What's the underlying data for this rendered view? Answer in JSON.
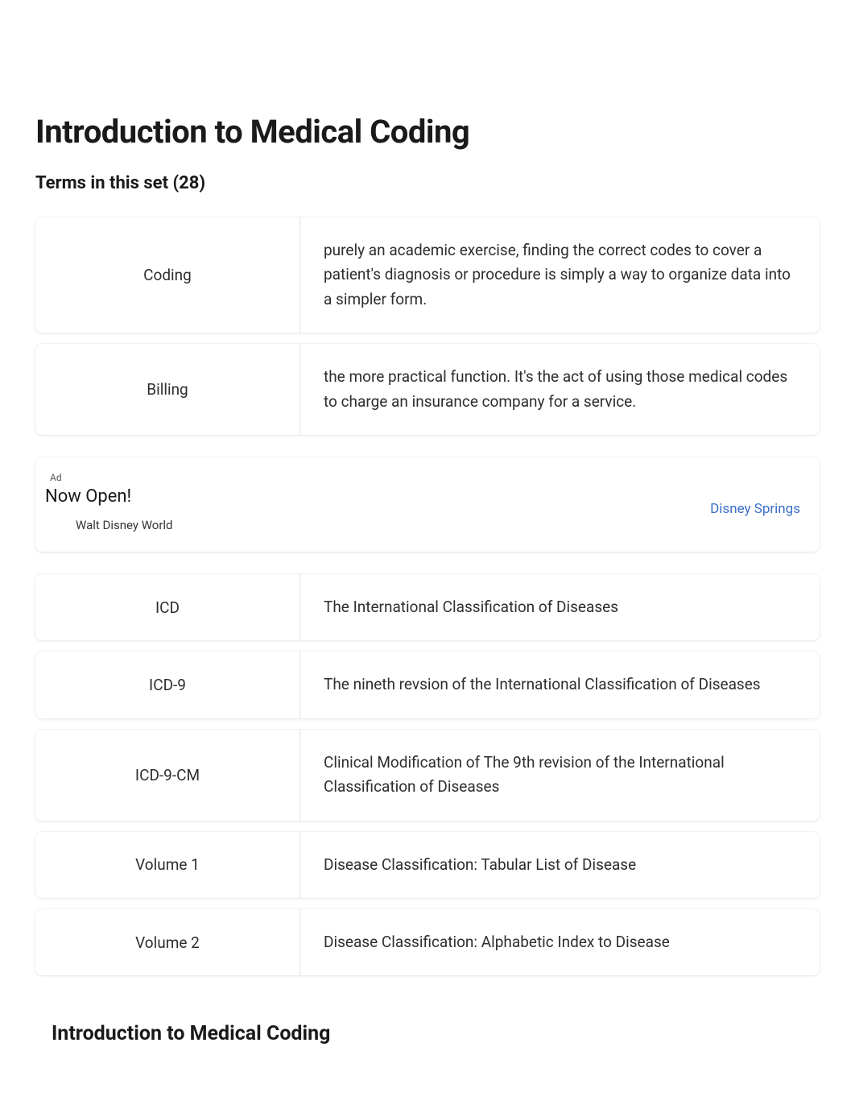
{
  "header": {
    "title": "Introduction to Medical Coding",
    "subtitle": "Terms in this set (28)"
  },
  "cards": [
    {
      "term": "Coding",
      "definition": "purely an academic exercise, finding the correct codes to cover a patient's diagnosis or procedure is simply a way to organize data into a simpler form."
    },
    {
      "term": "Billing",
      "definition": "the more practical function. It's the act of using those medical codes to charge an insurance company for a service."
    }
  ],
  "ad": {
    "label": "Ad",
    "headline": "Now Open!",
    "subtext": "Walt Disney World",
    "link_text": "Disney Springs"
  },
  "cards2": [
    {
      "term": "ICD",
      "definition": "The International Classification of Diseases"
    },
    {
      "term": "ICD-9",
      "definition": "The nineth revsion of the International Classification of Diseases"
    },
    {
      "term": "ICD-9-CM",
      "definition": "Clinical Modification of The 9th revision of the International Classification of Diseases"
    },
    {
      "term": "Volume 1",
      "definition": "Disease Classification: Tabular List of Disease"
    },
    {
      "term": "Volume 2",
      "definition": "Disease Classification: Alphabetic Index to Disease"
    }
  ],
  "footer": {
    "title": "Introduction to Medical Coding"
  }
}
